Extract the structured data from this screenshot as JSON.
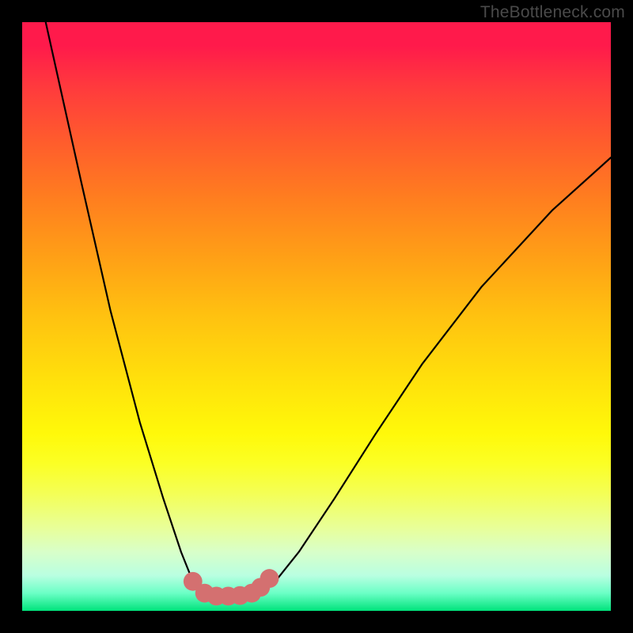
{
  "watermark": "TheBottleneck.com",
  "chart_data": {
    "type": "line",
    "title": "",
    "xlabel": "",
    "ylabel": "",
    "xlim": [
      0,
      100
    ],
    "ylim": [
      0,
      100
    ],
    "grid": false,
    "legend": false,
    "series": [
      {
        "name": "bottleneck-curve",
        "x": [
          4,
          10,
          15,
          20,
          24,
          27,
          29,
          31,
          32,
          33,
          34,
          35,
          36,
          37,
          38,
          40,
          43,
          47,
          53,
          60,
          68,
          78,
          90,
          100
        ],
        "values": [
          100,
          73,
          51,
          32,
          19,
          10,
          5,
          3,
          2.7,
          2.6,
          2.5,
          2.5,
          2.5,
          2.6,
          2.7,
          3,
          5,
          10,
          19,
          30,
          42,
          55,
          68,
          77
        ]
      }
    ],
    "markers": {
      "name": "highlight-points",
      "color": "#d47070",
      "radius_pct": 1.6,
      "points": [
        {
          "x": 29,
          "y": 5
        },
        {
          "x": 31,
          "y": 3
        },
        {
          "x": 33,
          "y": 2.5
        },
        {
          "x": 35,
          "y": 2.5
        },
        {
          "x": 37,
          "y": 2.6
        },
        {
          "x": 39,
          "y": 3
        },
        {
          "x": 40.5,
          "y": 4
        },
        {
          "x": 42,
          "y": 5.5
        }
      ]
    }
  }
}
